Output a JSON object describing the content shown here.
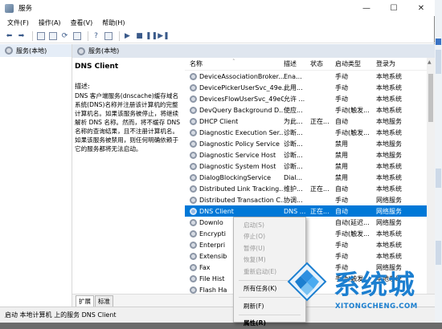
{
  "window": {
    "title": "服务"
  },
  "controls": {
    "minimize": "—",
    "maximize": "☐",
    "close": "✕"
  },
  "menu": [
    "文件(F)",
    "操作(A)",
    "查看(V)",
    "帮助(H)"
  ],
  "tree": {
    "item": "服务(本地)"
  },
  "header": {
    "title": "服务(本地)"
  },
  "details": {
    "service_name": "DNS Client",
    "desc_label": "描述:",
    "description": "DNS 客户端服务(dnscache)缓存域名系统(DNS)名称并注册该计算机的完整计算机名。如果该服务被停止，将继续解析 DNS 名称。然而，将不缓存 DNS 名称的查询结果，且不注册计算机名。如果该服务被禁用，则任何明确依赖于它的服务都将无法启动。"
  },
  "columns": [
    "名称",
    "描述",
    "状态",
    "启动类型",
    "登录为"
  ],
  "services": [
    [
      "DeviceAssociationBroker...",
      "Ena...",
      "",
      "手动",
      "本地系统"
    ],
    [
      "DevicePickerUserSvc_49e...",
      "此用...",
      "",
      "手动",
      "本地系统"
    ],
    [
      "DevicesFlowUserSvc_49e05",
      "允许 ...",
      "",
      "手动",
      "本地系统"
    ],
    [
      "DevQuery Background D...",
      "使应...",
      "",
      "手动(触发...",
      "本地系统"
    ],
    [
      "DHCP Client",
      "为此...",
      "正在...",
      "自动",
      "本地服务"
    ],
    [
      "Diagnostic Execution Ser...",
      "诊断...",
      "",
      "手动(触发...",
      "本地系统"
    ],
    [
      "Diagnostic Policy Service",
      "诊断...",
      "",
      "禁用",
      "本地服务"
    ],
    [
      "Diagnostic Service Host",
      "诊断...",
      "",
      "禁用",
      "本地服务"
    ],
    [
      "Diagnostic System Host",
      "诊断...",
      "",
      "禁用",
      "本地系统"
    ],
    [
      "DialogBlockingService",
      "Dial...",
      "",
      "禁用",
      "本地系统"
    ],
    [
      "Distributed Link Tracking...",
      "维护...",
      "正在...",
      "自动",
      "本地系统"
    ],
    [
      "Distributed Transaction C...",
      "协调...",
      "",
      "手动",
      "网络服务"
    ],
    [
      "DNS Client",
      "DNS ...",
      "正在...",
      "自动",
      "网络服务"
    ],
    [
      "Downlo",
      "",
      "",
      "自动(延迟...",
      "网络服务"
    ],
    [
      "Encrypti",
      "",
      "",
      "手动(触发...",
      "本地系统"
    ],
    [
      "Enterpri",
      "",
      "",
      "手动",
      "本地系统"
    ],
    [
      "Extensib",
      "",
      "",
      "手动",
      "本地系统"
    ],
    [
      "Fax",
      "",
      "",
      "手动",
      "网络服务"
    ],
    [
      "File Hist",
      "",
      "",
      "手动(触发...",
      "本地系统"
    ],
    [
      "Flash Ha",
      "",
      "",
      "",
      ""
    ]
  ],
  "selected_index": 12,
  "context_menu": {
    "start": "启动(S)",
    "stop": "停止(O)",
    "pause": "暂停(U)",
    "resume": "恢复(M)",
    "restart": "重新启动(E)",
    "all_tasks": "所有任务(K)",
    "refresh": "刷新(F)",
    "properties": "属性(R)"
  },
  "tabs": [
    "扩展",
    "标准"
  ],
  "status": "启动 本地计算机 上的服务 DNS Client",
  "watermark": {
    "title": "系统城",
    "subtitle": "XITONGCHENG.COM"
  },
  "colors": {
    "selection": "#0078d7",
    "header_band": "#dfe6ef",
    "watermark": "#1c7fd0"
  }
}
